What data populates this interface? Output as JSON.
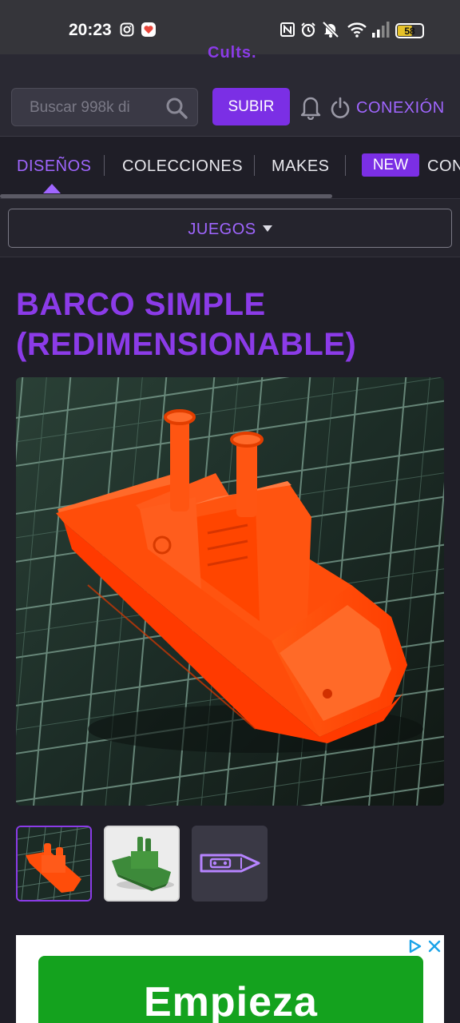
{
  "status_bar": {
    "time": "20:23",
    "battery": "58",
    "icons": [
      "instagram-icon",
      "heart-app-icon",
      "nfc-icon",
      "alarm-icon",
      "mute-icon",
      "wifi-icon",
      "signal-icon",
      "battery-icon"
    ]
  },
  "header": {
    "logo_fragment": "Cults.",
    "search_placeholder": "Buscar 998k di",
    "upload_label": "SUBIR",
    "login_label": "CONEXIÓN"
  },
  "tabs": {
    "items": [
      {
        "label": "DISEÑOS",
        "active": true
      },
      {
        "label": "COLECCIONES",
        "active": false
      },
      {
        "label": "MAKES",
        "active": false
      },
      {
        "label": "CON",
        "active": false
      }
    ],
    "new_badge": "NEW"
  },
  "category": {
    "label": "JUEGOS"
  },
  "design": {
    "title": "BARCO SIMPLE (REDIMENSIONABLE)",
    "thumbnail_count": 3
  },
  "ad": {
    "text": "Empieza"
  },
  "colors": {
    "accent": "#7b2fe5",
    "accent_text": "#a066ff",
    "background": "#1f1e27",
    "ad_green": "#14a21e"
  }
}
